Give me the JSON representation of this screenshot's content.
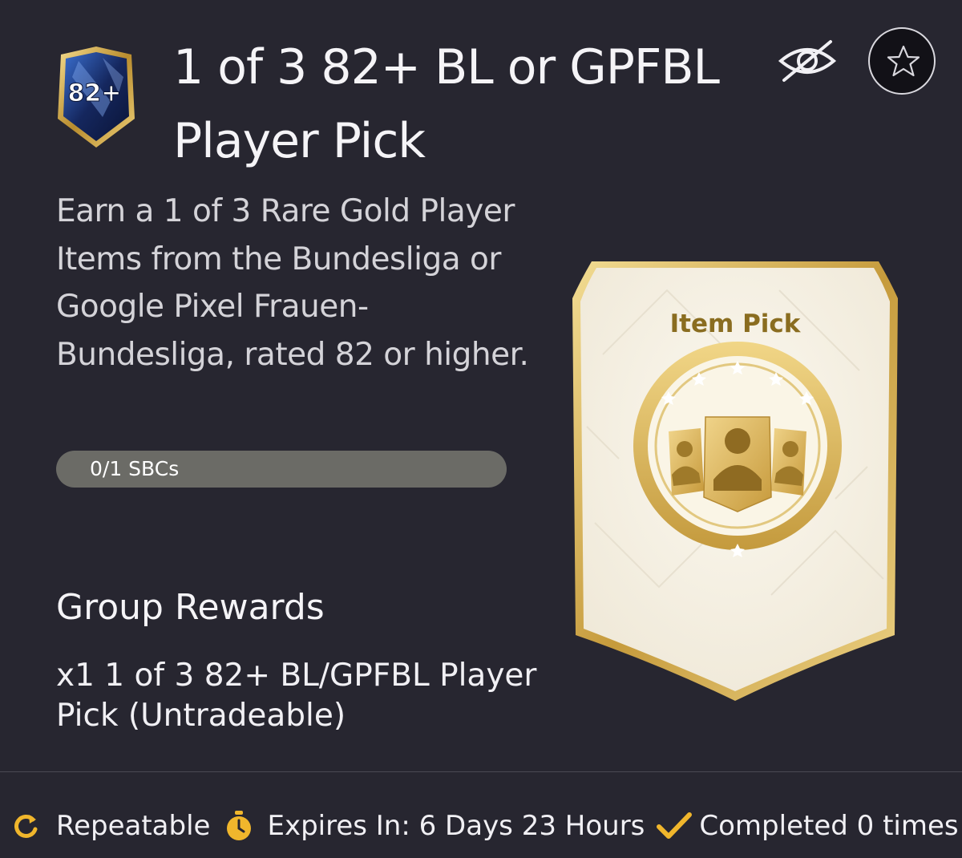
{
  "pack_badge": {
    "rating_text": "82+"
  },
  "title": "1 of 3 82+ BL or GPFBL Player Pick",
  "header_icons": {
    "hide": "eye-off-icon",
    "favorite": "star-outline-icon"
  },
  "description": "Earn a 1 of 3 Rare Gold Player Items from the Bundesliga or Google Pixel Frauen-Bundesliga, rated 82 or higher.",
  "progress": {
    "label": "0/1 SBCs",
    "completed": 0,
    "total": 1
  },
  "reward_card": {
    "title": "Item Pick"
  },
  "group_rewards": {
    "title": "Group Rewards",
    "reward": "x1 1 of 3 82+ BL/GPFBL Player Pick (Untradeable)"
  },
  "footer": {
    "repeatable": "Repeatable",
    "expires": "Expires In: 6 Days 23 Hours",
    "completed": "Completed 0 times"
  },
  "colors": {
    "background": "#272630",
    "accent_gold": "#f0b62c",
    "card_gold": "#c9a449"
  }
}
